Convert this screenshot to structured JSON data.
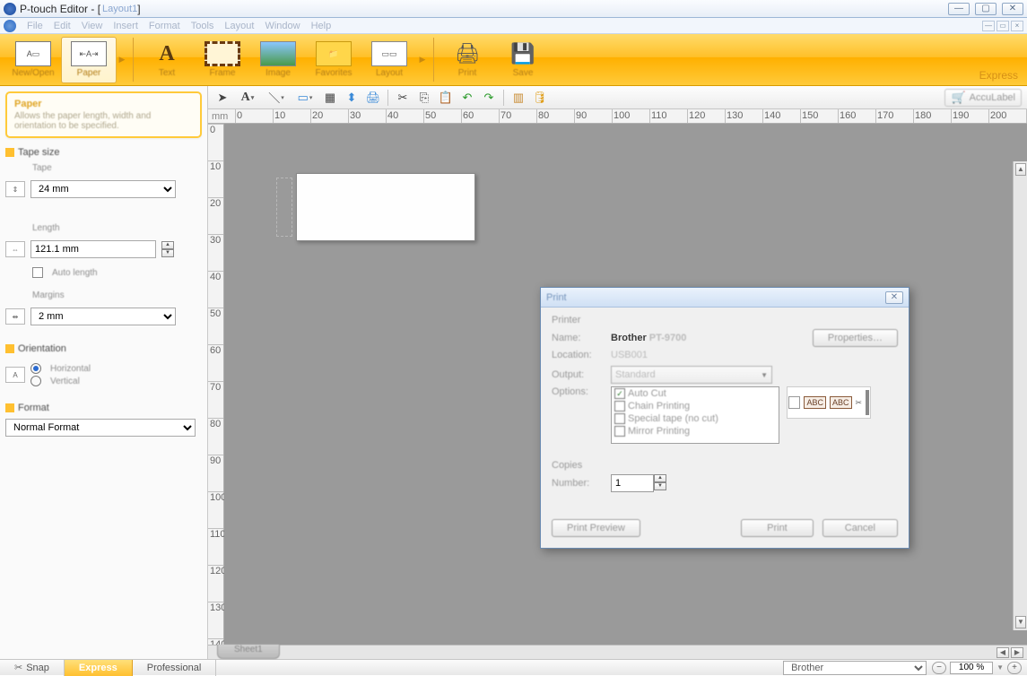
{
  "titlebar": {
    "app": "P-touch Editor - [",
    "doc": "Layout1",
    "close_bracket": "]"
  },
  "menu": [
    "File",
    "Edit",
    "View",
    "Insert",
    "Format",
    "Tools",
    "Layout",
    "Window",
    "Help"
  ],
  "ribbon": {
    "groups": [
      {
        "items": [
          {
            "name": "new-from",
            "label": "New/Open",
            "sel": false
          },
          {
            "name": "paper",
            "label": "Paper",
            "sel": true
          }
        ],
        "arrow": true
      },
      {
        "items": [
          {
            "name": "text",
            "label": "Text"
          },
          {
            "name": "frame",
            "label": "Frame"
          },
          {
            "name": "image",
            "label": "Image"
          },
          {
            "name": "favorites",
            "label": "Favorites"
          },
          {
            "name": "layout",
            "label": "Layout"
          }
        ],
        "arrow": true
      },
      {
        "items": [
          {
            "name": "print",
            "label": "Print"
          },
          {
            "name": "save",
            "label": "Save"
          }
        ]
      }
    ],
    "mode_label": "Express"
  },
  "hint": {
    "title": "Paper",
    "desc": "Allows the paper length, width and orientation to be specified."
  },
  "tapesize": {
    "header": "Tape size",
    "tape_label": "Tape",
    "tape_value": "24 mm",
    "length_label": "Length",
    "length_value": "121.1 mm",
    "auto_label": "Auto length",
    "margin_label": "Margins",
    "margin_value": "2 mm"
  },
  "orientation": {
    "header": "Orientation",
    "horizontal": "Horizontal",
    "vertical": "Vertical"
  },
  "format": {
    "header": "Format",
    "value": "Normal Format"
  },
  "toolbar2": {
    "items": [
      "pointer",
      "text-tool",
      "line-tool",
      "shape-tool",
      "table-tool",
      "arrange-tool",
      "print-tool",
      "cut",
      "copy",
      "paste",
      "undo",
      "redo",
      "screen",
      "db"
    ],
    "cart_label": "AccuLabel"
  },
  "ruler": {
    "unit": "mm"
  },
  "hscroll": {
    "tab": "Sheet1"
  },
  "dialog": {
    "title": "Print",
    "group_printer": "Printer",
    "name_label": "Name:",
    "name_value": "Brother",
    "name_model": "PT-9700",
    "location_label": "Location:",
    "location_value": "USB001",
    "output_label": "Output:",
    "output_value": "Standard",
    "options_label": "Options:",
    "options": [
      {
        "checked": true,
        "label": "Auto Cut"
      },
      {
        "checked": false,
        "label": "Chain Printing"
      },
      {
        "checked": false,
        "label": "Special tape (no cut)"
      },
      {
        "checked": false,
        "label": "Mirror Printing"
      }
    ],
    "properties_btn": "Properties…",
    "tape_preview": "ABC",
    "copies_group": "Copies",
    "number_label": "Number:",
    "number_value": "1",
    "preview_btn": "Print Preview",
    "print_btn": "Print",
    "cancel_btn": "Cancel"
  },
  "statusbar": {
    "snap": "Snap",
    "express": "Express",
    "professional": "Professional",
    "printer": "Brother",
    "zoom": "100 %"
  }
}
